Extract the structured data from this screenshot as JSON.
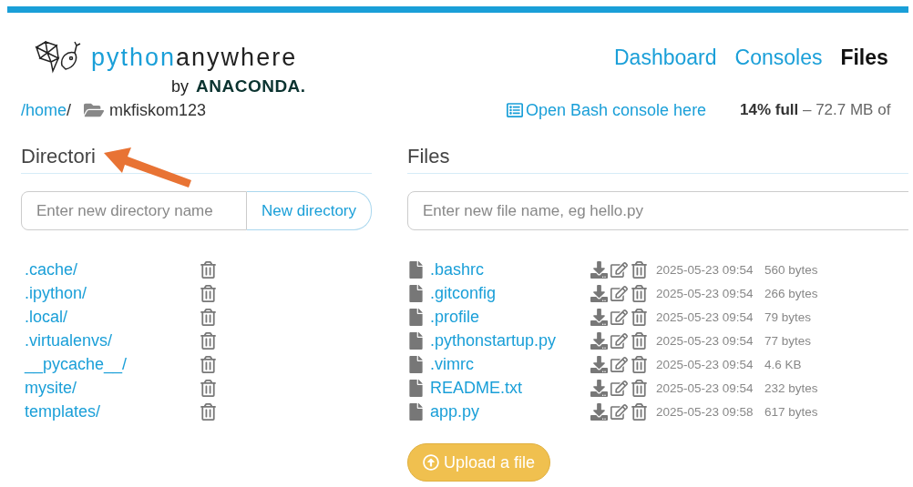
{
  "logo": {
    "name_accent": "python",
    "name_rest": "anywhere",
    "by": "by",
    "company": "ANACONDA."
  },
  "nav": [
    {
      "label": "Dashboard",
      "selected": false
    },
    {
      "label": "Consoles",
      "selected": false
    },
    {
      "label": "Files",
      "selected": true
    }
  ],
  "breadcrumb": {
    "parent": "/home",
    "separator": "/",
    "current": "mkfiskom123"
  },
  "bash_link": "Open Bash console here",
  "storage": "**14% full** – 72.7 MB of",
  "directories": {
    "heading": "Directori",
    "placeholder": "Enter new directory name",
    "button": "New directory",
    "items": [
      {
        "name": ".cache/"
      },
      {
        "name": ".ipython/"
      },
      {
        "name": ".local/"
      },
      {
        "name": ".virtualenvs/"
      },
      {
        "name": "__pycache__/"
      },
      {
        "name": "mysite/"
      },
      {
        "name": "templates/"
      }
    ]
  },
  "files": {
    "heading": "Files",
    "placeholder": "Enter new file name, eg hello.py",
    "items": [
      {
        "name": ".bashrc",
        "modified": "2025-05-23 09:54",
        "size": "560 bytes"
      },
      {
        "name": ".gitconfig",
        "modified": "2025-05-23 09:54",
        "size": "266 bytes"
      },
      {
        "name": ".profile",
        "modified": "2025-05-23 09:54",
        "size": "79 bytes"
      },
      {
        "name": ".pythonstartup.py",
        "modified": "2025-05-23 09:54",
        "size": "77 bytes"
      },
      {
        "name": ".vimrc",
        "modified": "2025-05-23 09:54",
        "size": "4.6 KB"
      },
      {
        "name": "README.txt",
        "modified": "2025-05-23 09:54",
        "size": "232 bytes"
      },
      {
        "name": "app.py",
        "modified": "2025-05-23 09:58",
        "size": "617 bytes"
      }
    ],
    "upload_button": "Upload a file"
  }
}
